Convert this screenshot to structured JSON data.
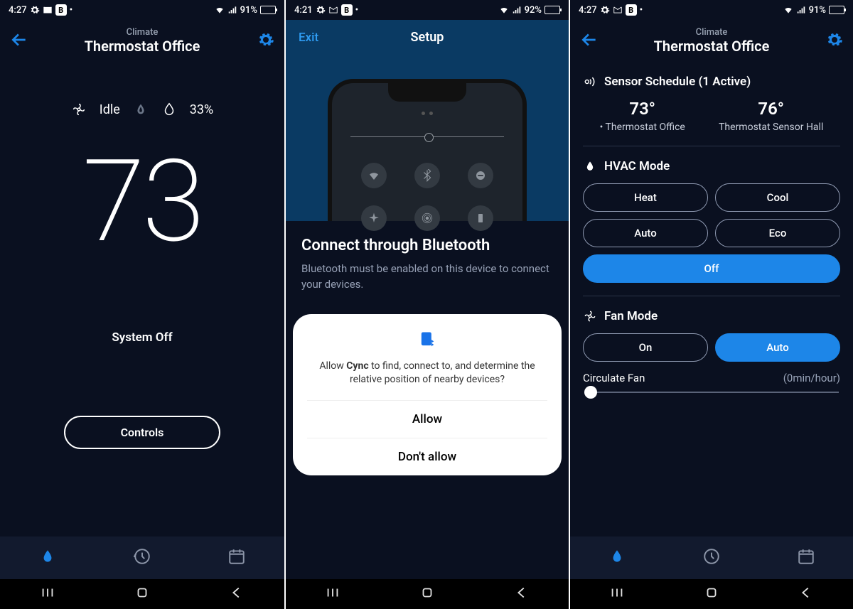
{
  "status": {
    "time1": "4:27",
    "time2": "4:21",
    "time3": "4:27",
    "battery1": "91%",
    "battery2": "92%",
    "battery3": "91%",
    "b_badge": "B"
  },
  "screen1": {
    "eyebrow": "Climate",
    "title": "Thermostat Office",
    "fan_status": "Idle",
    "humidity": "33%",
    "temperature": "73",
    "system_status": "System Off",
    "controls_label": "Controls"
  },
  "screen2": {
    "exit_label": "Exit",
    "title": "Setup",
    "heading": "Connect through Bluetooth",
    "body": "Bluetooth must be enabled on this device to connect your devices.",
    "perm_text_pre": "Allow ",
    "perm_app": "Cync",
    "perm_text_post": " to find, connect to, and determine the relative position of nearby devices?",
    "allow": "Allow",
    "deny": "Don't allow"
  },
  "screen3": {
    "eyebrow": "Climate",
    "title": "Thermostat Office",
    "sensor_header": "Sensor Schedule (1 Active)",
    "sensors": [
      {
        "temp": "73°",
        "label": "• Thermostat Office"
      },
      {
        "temp": "76°",
        "label": "Thermostat Sensor Hall"
      }
    ],
    "hvac_header": "HVAC Mode",
    "hvac_modes": [
      "Heat",
      "Cool",
      "Auto",
      "Eco",
      "Off"
    ],
    "fan_header": "Fan Mode",
    "fan_modes": [
      "On",
      "Auto"
    ],
    "circulate_label": "Circulate Fan",
    "circulate_value": "(0min/hour)"
  }
}
